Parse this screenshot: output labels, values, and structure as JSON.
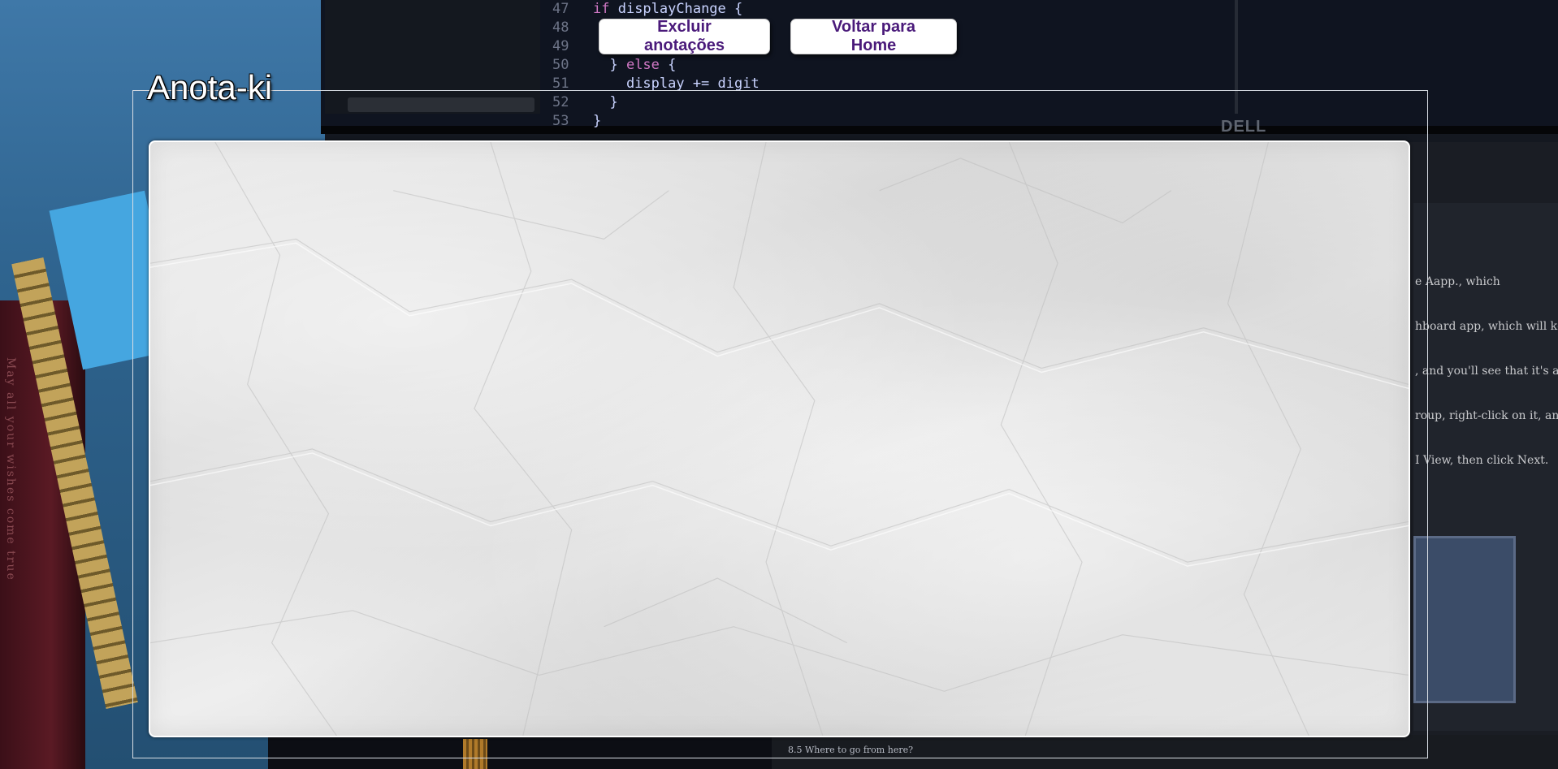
{
  "app": {
    "title": "Anota-ki"
  },
  "toolbar": {
    "delete_label": "Excluir anotações",
    "home_label": "Voltar para Home"
  },
  "notes": {
    "value": "",
    "placeholder": ""
  },
  "colors": {
    "button_text": "#4a1a7a",
    "button_bg": "#ffffff",
    "legend_text": "#ffffff",
    "fieldset_border": "#d8dde4",
    "paper": "#e4e4e4"
  }
}
